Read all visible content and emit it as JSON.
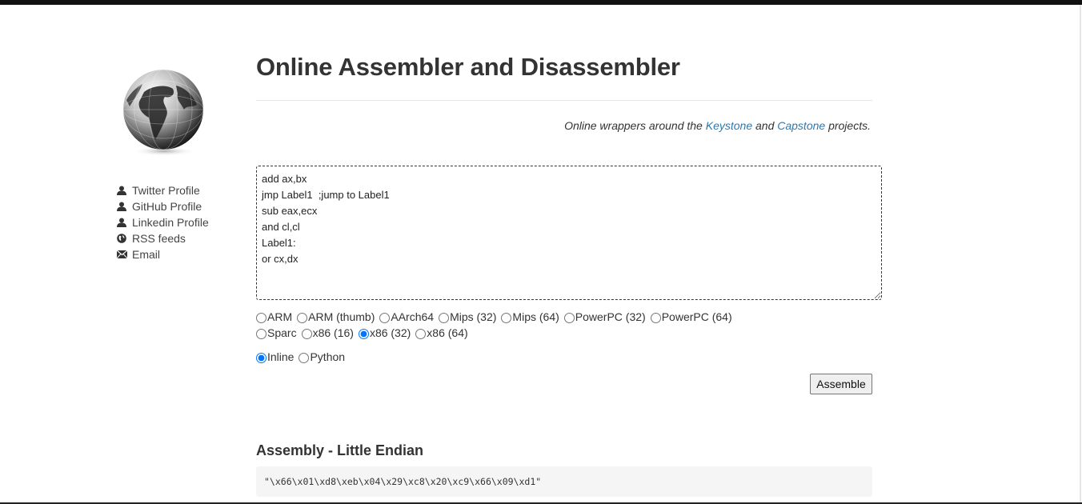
{
  "page": {
    "title": "Online Assembler and Disassembler",
    "tagline_prefix": "Online wrappers around the ",
    "tagline_link1": "Keystone",
    "tagline_and": " and ",
    "tagline_link2": "Capstone",
    "tagline_suffix": " projects."
  },
  "sidebar": {
    "links": [
      {
        "label": "Twitter Profile",
        "icon": "user-icon"
      },
      {
        "label": "GitHub Profile",
        "icon": "user-icon"
      },
      {
        "label": "Linkedin Profile",
        "icon": "user-icon"
      },
      {
        "label": "RSS feeds",
        "icon": "globe-icon"
      },
      {
        "label": "Email",
        "icon": "envelope-icon"
      }
    ]
  },
  "editor": {
    "code": "add ax,bx\njmp Label1  ;jump to Label1\nsub eax,ecx\nand cl,cl\nLabel1:\nor cx,dx"
  },
  "arch": {
    "options": [
      "ARM",
      "ARM (thumb)",
      "AArch64",
      "Mips (32)",
      "Mips (64)",
      "PowerPC (32)",
      "PowerPC (64)",
      "Sparc",
      "x86 (16)",
      "x86 (32)",
      "x86 (64)"
    ],
    "selected": "x86 (32)"
  },
  "format": {
    "options": [
      "Inline",
      "Python"
    ],
    "selected": "Inline"
  },
  "assemble_label": "Assemble",
  "result": {
    "heading": "Assembly - Little Endian",
    "output": "\"\\x66\\x01\\xd8\\xeb\\x04\\x29\\xc8\\x20\\xc9\\x66\\x09\\xd1\""
  },
  "colors": {
    "link": "#2a7ab0",
    "topbar": "#111111"
  }
}
